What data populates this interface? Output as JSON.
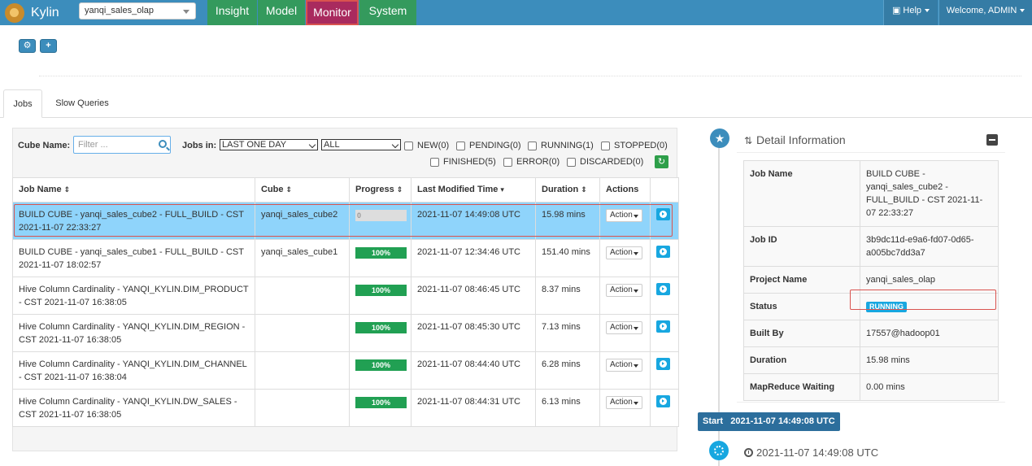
{
  "navbar": {
    "brand": "Kylin",
    "project": "yanqi_sales_olap",
    "tabs": [
      "Insight",
      "Model",
      "Monitor",
      "System"
    ],
    "active_tab": "Monitor",
    "help": "Help",
    "welcome": "Welcome, ADMIN"
  },
  "toolbar": {
    "gear_icon": "gear-icon",
    "plus_label": "+"
  },
  "page_tabs": {
    "jobs": "Jobs",
    "slow_queries": "Slow Queries"
  },
  "filters": {
    "cube_name_label": "Cube Name:",
    "cube_name_placeholder": "Filter ...",
    "jobs_in_label": "Jobs in:",
    "time_range": "LAST ONE DAY",
    "type": "ALL",
    "statuses": [
      "NEW(0)",
      "PENDING(0)",
      "RUNNING(1)",
      "STOPPED(0)",
      "FINISHED(5)",
      "ERROR(0)",
      "DISCARDED(0)"
    ]
  },
  "table": {
    "headers": [
      "Job Name",
      "Cube",
      "Progress",
      "Last Modified Time",
      "Duration",
      "Actions"
    ],
    "action_label": "Action",
    "rows": [
      {
        "name": "BUILD CUBE - yanqi_sales_cube2 - FULL_BUILD - CST 2021-11-07 22:33:27",
        "cube": "yanqi_sales_cube2",
        "progress": 0,
        "progress_label": "0",
        "modified": "2021-11-07 14:49:08 UTC",
        "duration": "15.98 mins"
      },
      {
        "name": "BUILD CUBE - yanqi_sales_cube1 - FULL_BUILD - CST 2021-11-07 18:02:57",
        "cube": "yanqi_sales_cube1",
        "progress": 100,
        "progress_label": "100%",
        "modified": "2021-11-07 12:34:46 UTC",
        "duration": "151.40 mins"
      },
      {
        "name": "Hive Column Cardinality - YANQI_KYLIN.DIM_PRODUCT - CST 2021-11-07 16:38:05",
        "cube": "",
        "progress": 100,
        "progress_label": "100%",
        "modified": "2021-11-07 08:46:45 UTC",
        "duration": "8.37 mins"
      },
      {
        "name": "Hive Column Cardinality - YANQI_KYLIN.DIM_REGION - CST 2021-11-07 16:38:05",
        "cube": "",
        "progress": 100,
        "progress_label": "100%",
        "modified": "2021-11-07 08:45:30 UTC",
        "duration": "7.13 mins"
      },
      {
        "name": "Hive Column Cardinality - YANQI_KYLIN.DIM_CHANNEL - CST 2021-11-07 16:38:04",
        "cube": "",
        "progress": 100,
        "progress_label": "100%",
        "modified": "2021-11-07 08:44:40 UTC",
        "duration": "6.28 mins"
      },
      {
        "name": "Hive Column Cardinality - YANQI_KYLIN.DW_SALES - CST 2021-11-07 16:38:05",
        "cube": "",
        "progress": 100,
        "progress_label": "100%",
        "modified": "2021-11-07 08:44:31 UTC",
        "duration": "6.13 mins"
      }
    ]
  },
  "detail": {
    "title": "Detail Information",
    "rows": [
      {
        "key": "Job Name",
        "value": "BUILD CUBE - yanqi_sales_cube2 - FULL_BUILD - CST 2021-11-07 22:33:27"
      },
      {
        "key": "Job ID",
        "value": "3b9dc11d-e9a6-fd07-0d65-a005bc7dd3a7"
      },
      {
        "key": "Project Name",
        "value": "yanqi_sales_olap"
      },
      {
        "key": "Status",
        "value": "RUNNING"
      },
      {
        "key": "Built By",
        "value": "17557@hadoop01"
      },
      {
        "key": "Duration",
        "value": "15.98 mins"
      },
      {
        "key": "MapReduce Waiting",
        "value": "0.00 mins"
      }
    ],
    "start_label": "Start",
    "start_time": "2021-11-07 14:49:08 UTC",
    "step_time": "2021-11-07 14:49:08 UTC"
  },
  "colors": {
    "navbar": "#3c8dbc",
    "tab_green": "#349a5d",
    "tab_active": "#a92a5e",
    "progress": "#21a053",
    "selected_row": "#8fd4fb",
    "running": "#18a7e0"
  }
}
